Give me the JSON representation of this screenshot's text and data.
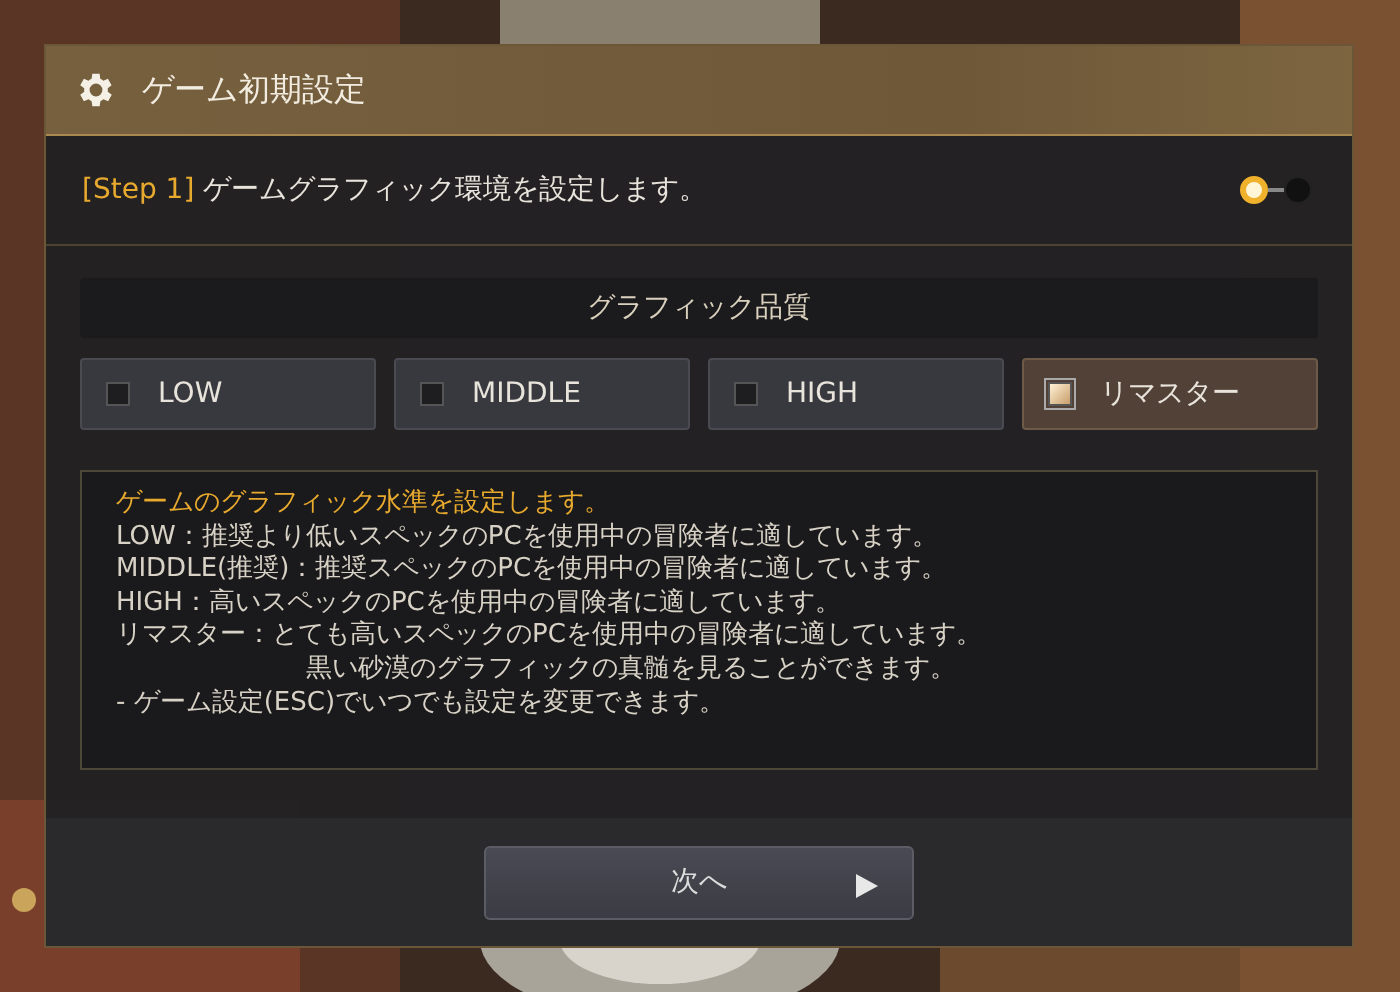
{
  "window": {
    "title": "ゲーム初期設定"
  },
  "step": {
    "tag": "[Step 1]",
    "text": "ゲームグラフィック環境を設定します。"
  },
  "step_dots": [
    {
      "selected": true
    },
    {
      "selected": false
    }
  ],
  "quality": {
    "heading": "グラフィック品質",
    "options": [
      {
        "label": "LOW",
        "checked": false
      },
      {
        "label": "MIDDLE",
        "checked": false
      },
      {
        "label": "HIGH",
        "checked": false
      },
      {
        "label": "リマスター",
        "checked": true
      }
    ]
  },
  "description": [
    {
      "kind": "highlight",
      "text": "ゲームのグラフィック水準を設定します。"
    },
    {
      "kind": "normal",
      "text": "LOW：推奨より低いスペックのPCを使用中の冒険者に適しています。"
    },
    {
      "kind": "normal",
      "text": "MIDDLE(推奨)：推奨スペックのPCを使用中の冒険者に適しています。"
    },
    {
      "kind": "normal",
      "text": "HIGH：高いスペックのPCを使用中の冒険者に適しています。"
    },
    {
      "kind": "normal",
      "text": "リマスター：とても高いスペックのPCを使用中の冒険者に適しています。"
    },
    {
      "kind": "indent",
      "text": "黒い砂漠のグラフィックの真髄を見ることができます。"
    },
    {
      "kind": "normal",
      "text": "- ゲーム設定(ESC)でいつでも設定を変更できます。"
    }
  ],
  "next_button": {
    "label": "次へ"
  }
}
